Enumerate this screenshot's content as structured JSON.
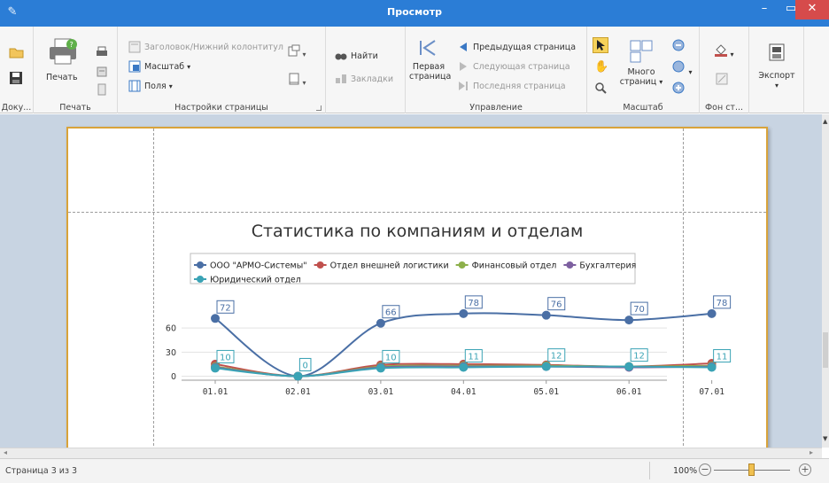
{
  "window": {
    "title": "Просмотр"
  },
  "ribbon": {
    "document": {
      "open_label": "",
      "save_label": "",
      "group_label": "Доку..."
    },
    "print": {
      "print_label": "Печать",
      "group_label": "Печать"
    },
    "page_setup": {
      "header_footer_label": "Заголовок/Нижний колонтитул",
      "scale_label": "Масштаб",
      "margins_label": "Поля",
      "group_label": "Настройки страницы"
    },
    "find": {
      "find_label": "Найти",
      "bookmarks_label": "Закладки"
    },
    "navigation": {
      "first_page_line1": "Первая",
      "first_page_line2": "страница",
      "prev_page_label": "Предыдущая страница",
      "next_page_label": "Следующая страница",
      "last_page_label": "Последняя страница",
      "group_label": "Управление"
    },
    "zoom": {
      "many_pages_line1": "Много",
      "many_pages_line2": "страниц",
      "group_label": "Масштаб"
    },
    "background": {
      "group_label": "Фон ст..."
    },
    "export": {
      "export_label": "Экспорт"
    }
  },
  "chart_data": {
    "type": "line",
    "title": "Статистика по компаниям и отделам",
    "categories": [
      "01.01",
      "02.01",
      "03.01",
      "04.01",
      "05.01",
      "06.01",
      "07.01"
    ],
    "yticks": [
      0,
      30,
      60
    ],
    "ylim": [
      -5,
      90
    ],
    "legend_position": "top",
    "series": [
      {
        "name": "ООО \"АРМО-Системы\"",
        "color": "#4a6fa5",
        "values": [
          72,
          0,
          66,
          78,
          76,
          70,
          78
        ],
        "labels": true
      },
      {
        "name": "Отдел внешней логистики",
        "color": "#c0504d",
        "values": [
          15,
          0,
          14,
          15,
          14,
          12,
          16
        ],
        "labels": false
      },
      {
        "name": "Финансовый отдел",
        "color": "#8db04a",
        "values": [
          12,
          0,
          12,
          13,
          13,
          12,
          13
        ],
        "labels": false
      },
      {
        "name": "Бухгалтерия",
        "color": "#7d60a0",
        "values": [
          11,
          0,
          11,
          12,
          12,
          11,
          12
        ],
        "labels": false
      },
      {
        "name": "Юридический отдел",
        "color": "#3aa3b5",
        "values": [
          10,
          0,
          10,
          11,
          12,
          12,
          11
        ],
        "labels": true
      }
    ]
  },
  "status": {
    "page_info": "Страница 3 из 3",
    "zoom": "100%"
  }
}
